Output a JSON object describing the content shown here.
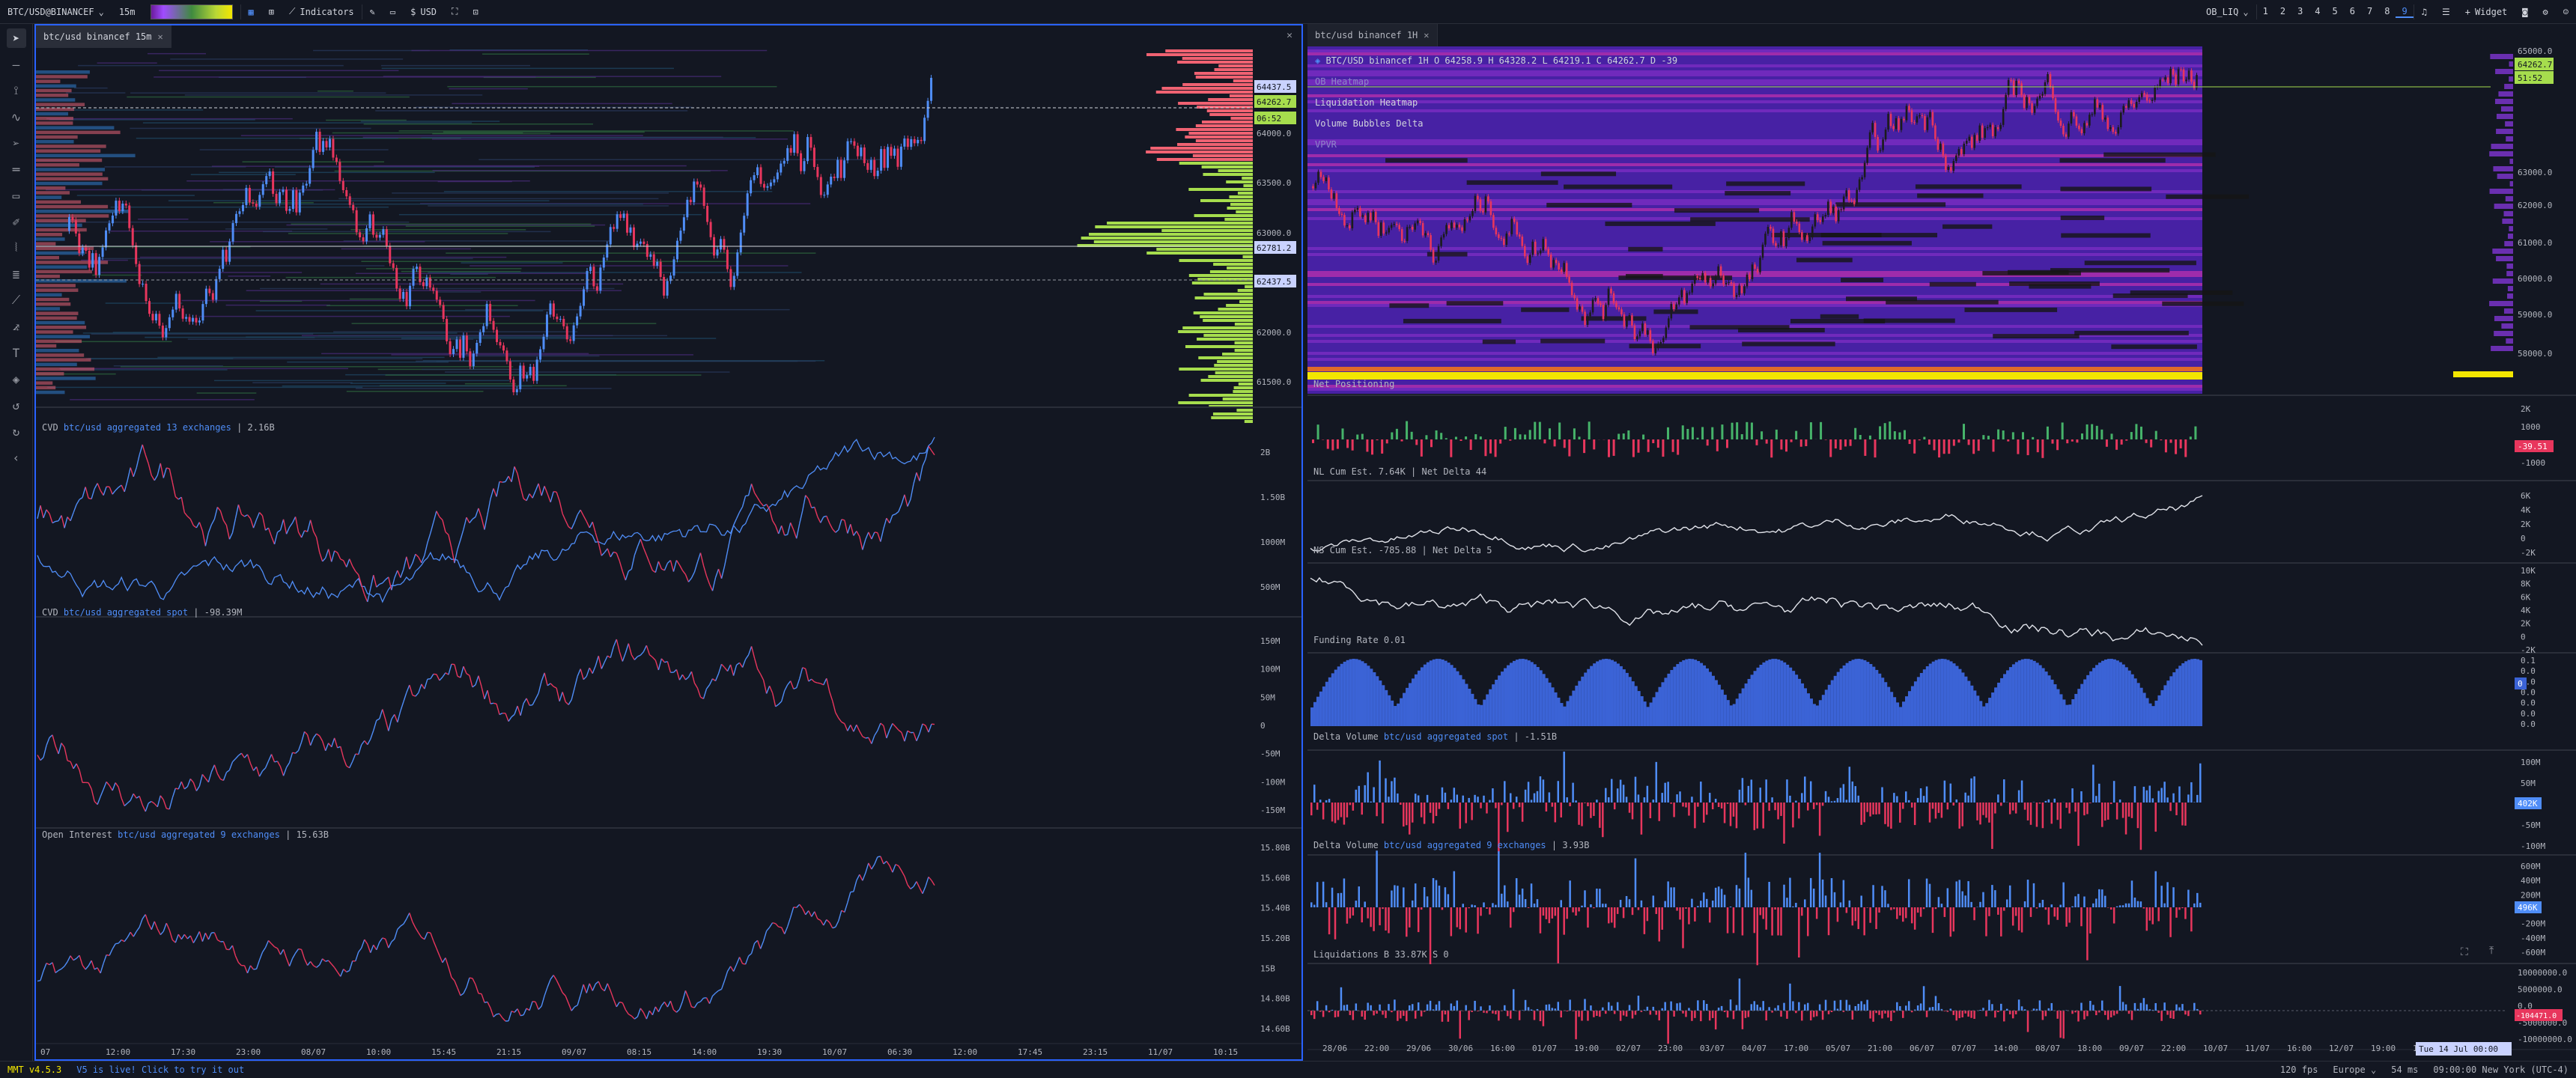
{
  "toolbar": {
    "symbol": "BTC/USD@BINANCEF",
    "interval": "15m",
    "indicators_label": "Indicators",
    "currency": "USD",
    "layout": "OB_LIQ",
    "workspaces": [
      "1",
      "2",
      "3",
      "4",
      "5",
      "6",
      "7",
      "8",
      "9"
    ],
    "active_workspace": "9",
    "widget_label": "Widget"
  },
  "status": {
    "version": "MMT v4.5.3",
    "live_message": "V5 is live! Click to try it out",
    "fps": "120 fps",
    "region": "Europe",
    "latency": "54 ms",
    "clock": "09:00:00 New York (UTC-4)"
  },
  "left": {
    "tab": "btc/usd binancef 15m",
    "price_labels": [
      "64437.5",
      "64262.7",
      "06:52",
      "64000.0",
      "63500.0",
      "63000.0",
      "62781.2",
      "62437.5",
      "62000.0",
      "61500.0"
    ],
    "cvd_legend_prefix": "CVD ",
    "cvd_legend_source": "btc/usd aggregated 13 exchanges",
    "cvd_legend_value": " | 2.16B",
    "cvd_axis": [
      "2B",
      "1.50B",
      "1000M",
      "500M"
    ],
    "spot_legend_prefix": "CVD ",
    "spot_legend_source": "btc/usd aggregated spot",
    "spot_legend_value": " | -98.39M",
    "spot_axis": [
      "150M",
      "100M",
      "50M",
      "0",
      "-50M",
      "-100M",
      "-150M"
    ],
    "oi_legend_prefix": "Open Interest ",
    "oi_legend_source": "btc/usd aggregated 9 exchanges",
    "oi_legend_value": " | 15.63B",
    "oi_axis": [
      "15.80B",
      "15.60B",
      "15.40B",
      "15.20B",
      "15B",
      "14.80B",
      "14.60B"
    ],
    "time_axis": [
      "07",
      "12:00",
      "17:30",
      "23:00",
      "08/07",
      "10:00",
      "15:45",
      "21:15",
      "09/07",
      "08:15",
      "14:00",
      "19:30",
      "10/07",
      "06:30",
      "12:00",
      "17:45",
      "23:15",
      "11/07",
      "10:15"
    ]
  },
  "right": {
    "tab": "btc/usd binancef 1H",
    "ohlc": "BTC/USD binancef 1H O 64258.9 H 64328.2 L 64219.1 C 64262.7 D -39",
    "overlays": [
      "OB Heatmap",
      "Liquidation Heatmap",
      "Volume Bubbles Delta",
      "VPVR"
    ],
    "price_labels": [
      "64262.7",
      "51:52",
      "65000.0",
      "63000.0",
      "62000.0",
      "61000.0",
      "60000.0",
      "59000.0",
      "58000.0"
    ],
    "net_positioning": "Net Positioning",
    "np_axis": [
      "2K",
      "1000",
      "0",
      "-1000"
    ],
    "np_last": "-39.51",
    "nl_legend": "NL Cum Est. 7.64K | Net Delta 44",
    "nl_axis": [
      "6K",
      "4K",
      "2K",
      "0",
      "-2K"
    ],
    "ns_legend": "NS Cum Est. -785.88 | Net Delta 5",
    "ns_axis": [
      "10K",
      "8K",
      "6K",
      "4K",
      "2K",
      "0",
      "-2K"
    ],
    "funding_legend": "Funding Rate 0.01",
    "funding_axis": [
      "0.1",
      "0.0",
      "0.0",
      "0.0",
      "0.0",
      "0.0",
      "0.0"
    ],
    "funding_last": "0",
    "dv_spot_prefix": "Delta Volume ",
    "dv_spot_source": "btc/usd aggregated spot",
    "dv_spot_value": " | -1.51B",
    "dv_spot_axis": [
      "100M",
      "50M",
      "0",
      "-50M",
      "-100M"
    ],
    "dv_spot_last": "402K",
    "dv_agg_prefix": "Delta Volume ",
    "dv_agg_source": "btc/usd aggregated 9 exchanges",
    "dv_agg_value": " | 3.93B",
    "dv_agg_axis": [
      "600M",
      "400M",
      "200M",
      "0",
      "-200M",
      "-400M",
      "-600M"
    ],
    "dv_agg_last": "496K",
    "liq_legend": "Liquidations B 33.87K S 0",
    "liq_axis": [
      "10000000.0",
      "5000000.0",
      "0.0",
      "-5000000.0",
      "-10000000.0"
    ],
    "liq_last": "-104471.0",
    "time_axis": [
      "28/06",
      "22:00",
      "29/06",
      "30/06",
      "16:00",
      "01/07",
      "19:00",
      "02/07",
      "23:00",
      "03/07",
      "04/07",
      "17:00",
      "05/07",
      "21:00",
      "06/07",
      "07/07",
      "14:00",
      "08/07",
      "18:00",
      "09/07",
      "22:00",
      "10/07",
      "11/07",
      "16:00",
      "12/07",
      "19:00",
      "13/07"
    ],
    "time_cursor": "Tue 14 Jul 00:00"
  },
  "colors": {
    "bg": "#131722",
    "up": "#4f8df7",
    "down": "#e8365d",
    "green": "#a6dd4d",
    "red": "#f06272",
    "heat": "#4b1fa3"
  }
}
